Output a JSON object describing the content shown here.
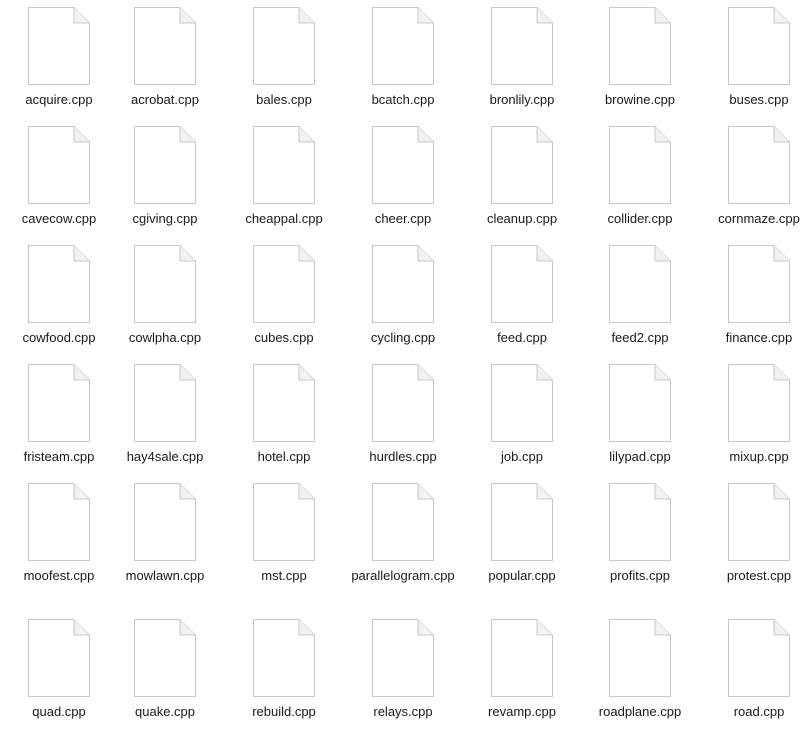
{
  "files": [
    {
      "name": "acquire.cpp"
    },
    {
      "name": "acrobat.cpp"
    },
    {
      "name": "bales.cpp"
    },
    {
      "name": "bcatch.cpp"
    },
    {
      "name": "bronlily.cpp"
    },
    {
      "name": "browine.cpp"
    },
    {
      "name": "buses.cpp"
    },
    {
      "name": "cavecow.cpp"
    },
    {
      "name": "cgiving.cpp"
    },
    {
      "name": "cheappal.cpp"
    },
    {
      "name": "cheer.cpp"
    },
    {
      "name": "cleanup.cpp"
    },
    {
      "name": "collider.cpp"
    },
    {
      "name": "cornmaze.cpp"
    },
    {
      "name": "cowfood.cpp"
    },
    {
      "name": "cowlpha.cpp"
    },
    {
      "name": "cubes.cpp"
    },
    {
      "name": "cycling.cpp"
    },
    {
      "name": "feed.cpp"
    },
    {
      "name": "feed2.cpp"
    },
    {
      "name": "finance.cpp"
    },
    {
      "name": "fristeam.cpp"
    },
    {
      "name": "hay4sale.cpp"
    },
    {
      "name": "hotel.cpp"
    },
    {
      "name": "hurdles.cpp"
    },
    {
      "name": "job.cpp"
    },
    {
      "name": "lilypad.cpp"
    },
    {
      "name": "mixup.cpp"
    },
    {
      "name": "moofest.cpp"
    },
    {
      "name": "mowlawn.cpp"
    },
    {
      "name": "mst.cpp"
    },
    {
      "name": "parallelogram.cpp"
    },
    {
      "name": "popular.cpp"
    },
    {
      "name": "profits.cpp"
    },
    {
      "name": "protest.cpp"
    },
    {
      "name": "quad.cpp"
    },
    {
      "name": "quake.cpp"
    },
    {
      "name": "rebuild.cpp"
    },
    {
      "name": "relays.cpp"
    },
    {
      "name": "revamp.cpp"
    },
    {
      "name": "roadplane.cpp"
    },
    {
      "name": "road.cpp"
    }
  ],
  "icon": "document-file-icon",
  "colors": {
    "page_fill": "#ffffff",
    "page_stroke": "#c9c9c9",
    "fold_fill": "#f1f1f1",
    "label": "#1a1a1a"
  }
}
